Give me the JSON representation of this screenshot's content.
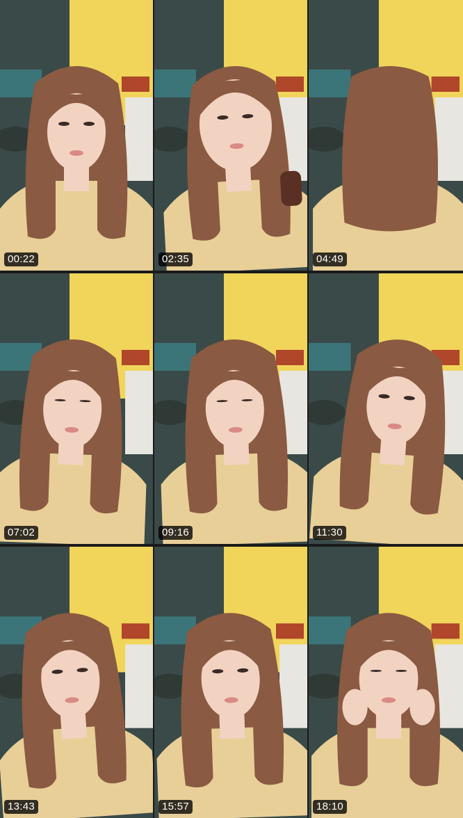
{
  "frames": [
    {
      "timestamp": "00:22",
      "pose": "front",
      "head_dx": 0,
      "tilt": 0
    },
    {
      "timestamp": "02:35",
      "pose": "close",
      "head_dx": 8,
      "tilt": -3
    },
    {
      "timestamp": "04:49",
      "pose": "back",
      "head_dx": 6,
      "tilt": 0
    },
    {
      "timestamp": "07:02",
      "pose": "down",
      "head_dx": -6,
      "tilt": 2
    },
    {
      "timestamp": "09:16",
      "pose": "down",
      "head_dx": 6,
      "tilt": -2
    },
    {
      "timestamp": "11:30",
      "pose": "side",
      "head_dx": 14,
      "tilt": 4
    },
    {
      "timestamp": "13:43",
      "pose": "front",
      "head_dx": -8,
      "tilt": -4
    },
    {
      "timestamp": "15:57",
      "pose": "front",
      "head_dx": 0,
      "tilt": -2
    },
    {
      "timestamp": "18:10",
      "pose": "hands",
      "head_dx": 4,
      "tilt": 0
    }
  ],
  "colors": {
    "wall_yellow": "#f1d45a",
    "wall_dark": "#3a4a48",
    "shelf_teal": "#3c7f86",
    "hair": "#8a5a42",
    "skin": "#f2d3c2",
    "dress": "#e8cf98",
    "timestamp_bg": "#000000",
    "timestamp_text": "#ffffff"
  }
}
